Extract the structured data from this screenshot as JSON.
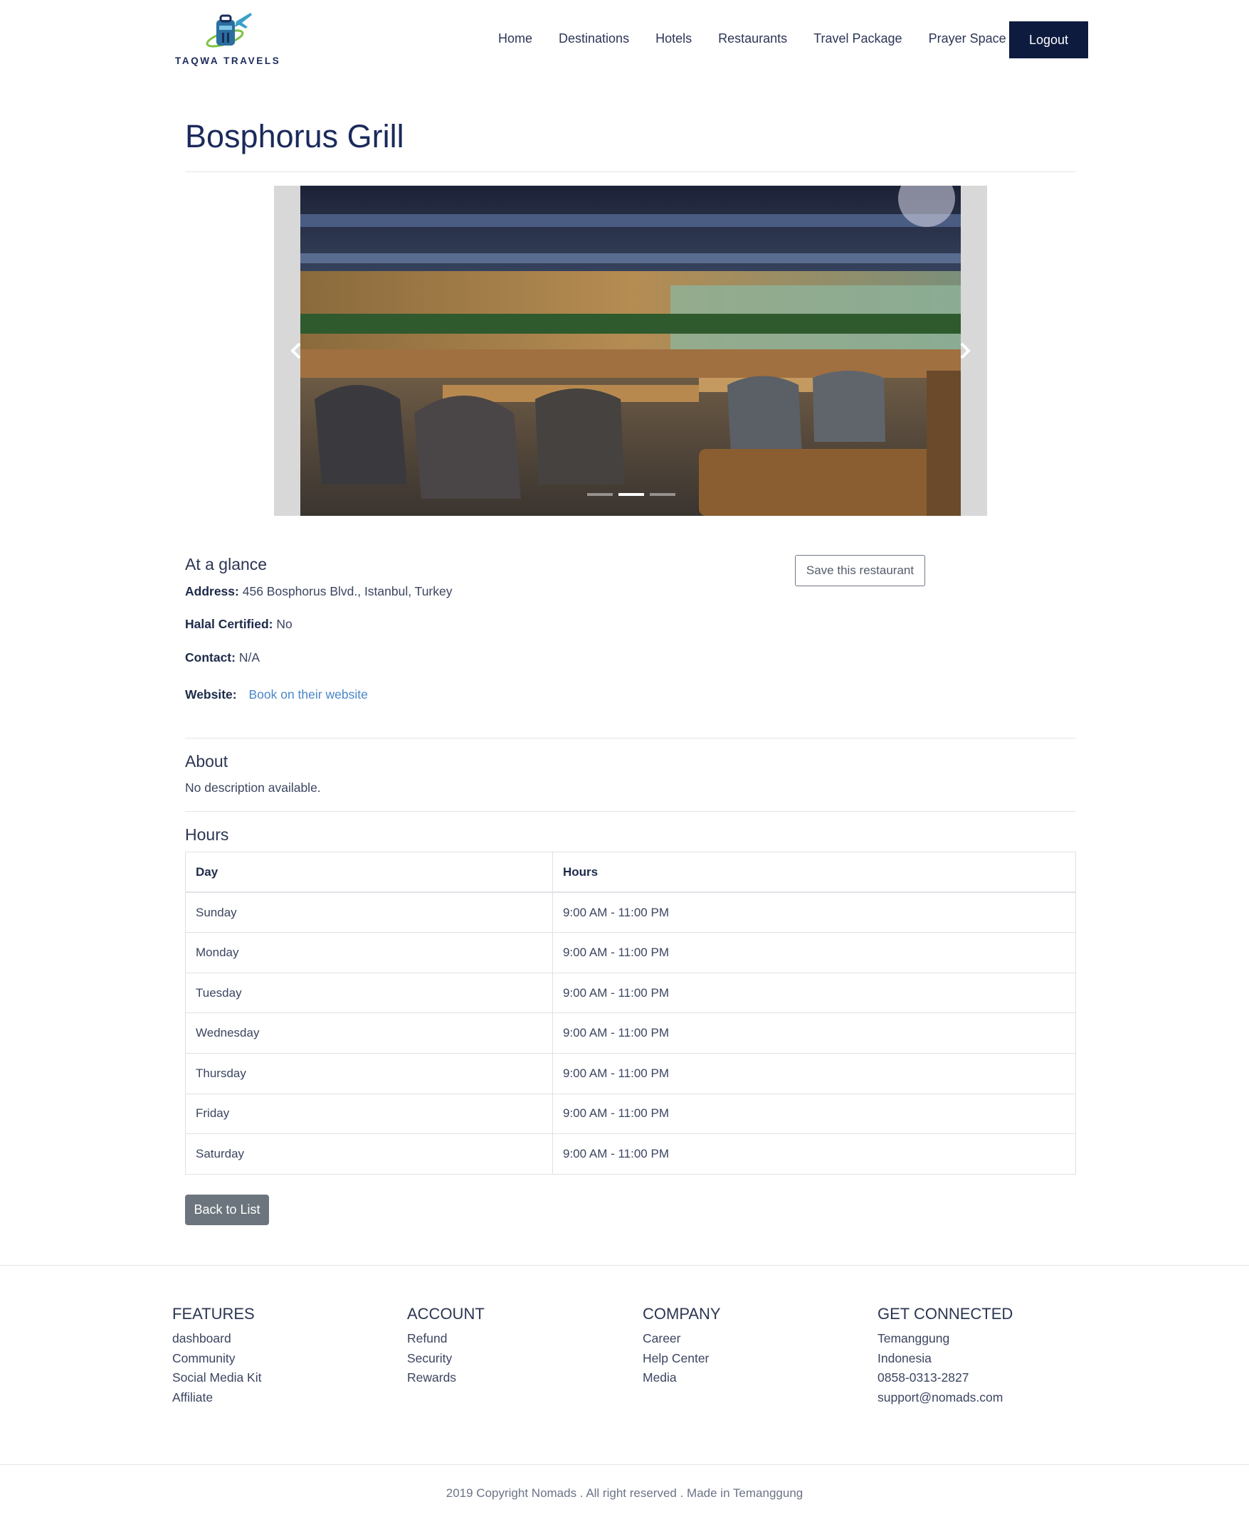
{
  "brand": {
    "name": "TAQWA TRAVELS"
  },
  "nav": {
    "items": [
      "Home",
      "Destinations",
      "Hotels",
      "Restaurants",
      "Travel Package",
      "Prayer Space"
    ],
    "logout_label": "Logout"
  },
  "restaurant": {
    "title": "Bosphorus Grill",
    "carousel": {
      "slide_count": 3,
      "active_index": 1
    },
    "glance": {
      "heading": "At a glance",
      "address_label": "Address:",
      "address": "456 Bosphorus Blvd., Istanbul, Turkey",
      "halal_label": "Halal Certified:",
      "halal": "No",
      "contact_label": "Contact:",
      "contact": "N/A",
      "website_label": "Website:",
      "website_link": "Book on their website"
    },
    "save_label": "Save this restaurant",
    "about": {
      "heading": "About",
      "text": "No description available."
    },
    "hours": {
      "heading": "Hours",
      "columns": [
        "Day",
        "Hours"
      ],
      "rows": [
        [
          "Sunday",
          "9:00 AM - 11:00 PM"
        ],
        [
          "Monday",
          "9:00 AM - 11:00 PM"
        ],
        [
          "Tuesday",
          "9:00 AM - 11:00 PM"
        ],
        [
          "Wednesday",
          "9:00 AM - 11:00 PM"
        ],
        [
          "Thursday",
          "9:00 AM - 11:00 PM"
        ],
        [
          "Friday",
          "9:00 AM - 11:00 PM"
        ],
        [
          "Saturday",
          "9:00 AM - 11:00 PM"
        ]
      ]
    },
    "back_label": "Back to List"
  },
  "footer": {
    "columns": [
      {
        "heading": "FEATURES",
        "items": [
          "dashboard",
          "Community",
          "Social Media Kit",
          "Affiliate"
        ]
      },
      {
        "heading": "ACCOUNT",
        "items": [
          "Refund",
          "Security",
          "Rewards"
        ]
      },
      {
        "heading": "COMPANY",
        "items": [
          "Career",
          "Help Center",
          "Media"
        ]
      },
      {
        "heading": "GET CONNECTED",
        "items": [
          "Temanggung",
          "Indonesia",
          "0858-0313-2827",
          "support@nomads.com"
        ]
      }
    ],
    "copyright": "2019 Copyright Nomads . All right reserved . Made in Temanggung"
  },
  "colors": {
    "primary": "#0d1b3e",
    "link": "#4a86c8",
    "secondary_button": "#6c757d"
  }
}
